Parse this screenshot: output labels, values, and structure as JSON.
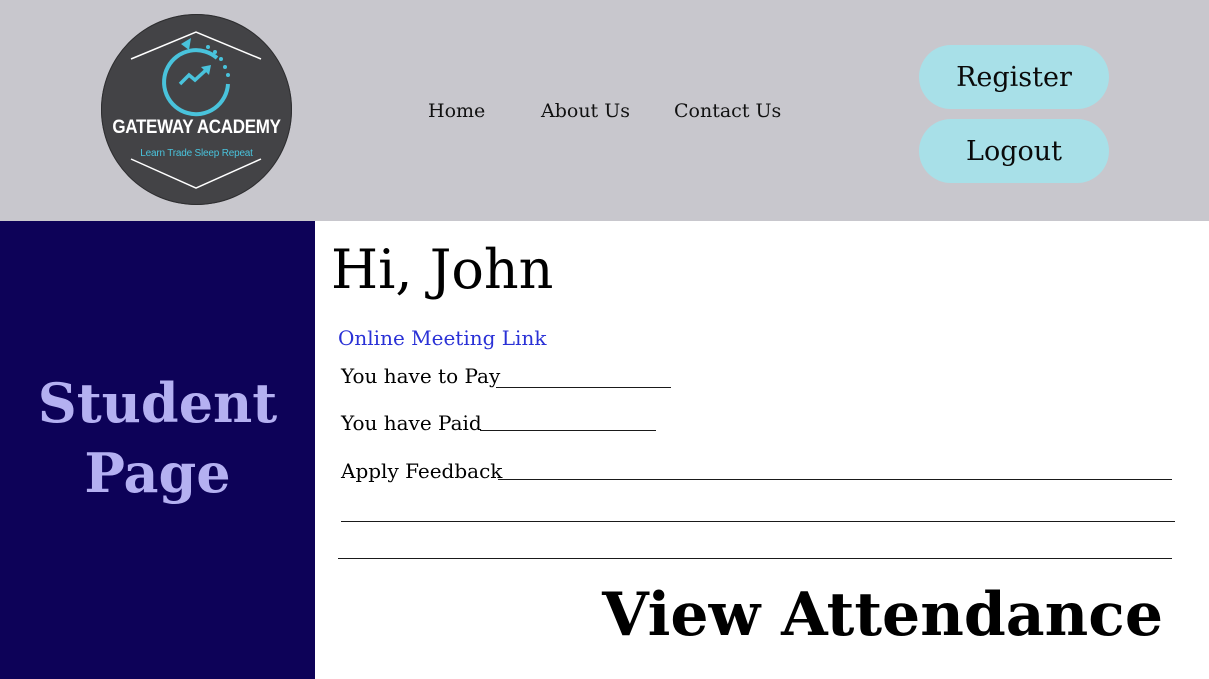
{
  "logo": {
    "name": "GATEWAY ACADEMY",
    "tagline": "Learn Trade Sleep Repeat",
    "colors": {
      "background": "#434346",
      "accent": "#49c3dc"
    }
  },
  "nav": {
    "home": "Home",
    "about": "About Us",
    "contact": "Contact Us"
  },
  "actions": {
    "register": "Register",
    "logout": "Logout"
  },
  "sidebar": {
    "title_line1": "Student",
    "title_line2": "Page"
  },
  "main": {
    "greeting": "Hi, John",
    "meeting_link": "Online Meeting Link",
    "pay_label": "You have to Pay",
    "paid_label": "You have Paid",
    "feedback_label": "Apply Feedback",
    "attendance_button": "View Attendance"
  },
  "colors": {
    "header_bg": "#c8c7cd",
    "sidebar_bg": "#0d0258",
    "sidebar_text": "#b4b0f1",
    "pill_bg": "#a8e0e8",
    "link": "#2a31d6"
  }
}
